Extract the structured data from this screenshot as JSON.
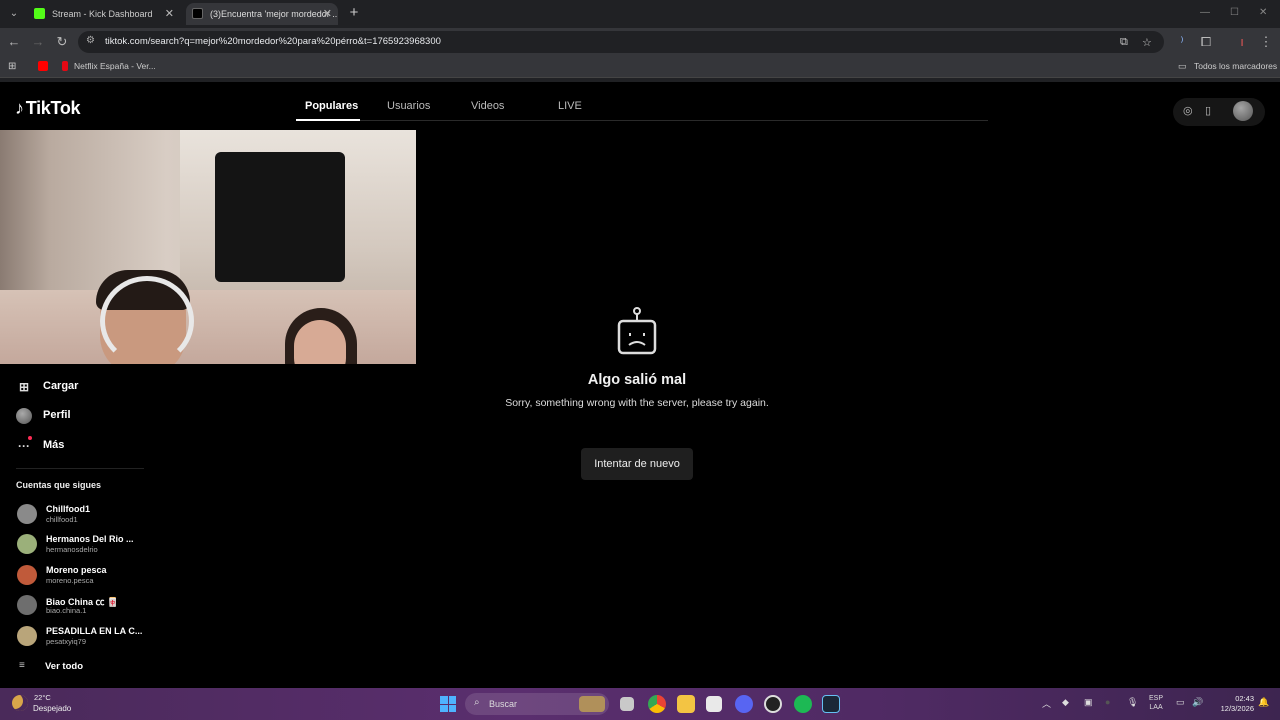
{
  "browser": {
    "tabs": [
      {
        "title": "Stream - Kick Dashboard",
        "favicon_color": "#53fc18"
      },
      {
        "title": "(3)Encuentra 'mejor mordedor ...",
        "favicon_color": "#000000"
      }
    ],
    "url": "tiktok.com/search?q=mejor%20mordedor%20para%20pérro&t=1765923968300",
    "bookmarks": [
      {
        "label": "Netflix España - Ver...",
        "color": "#e50914"
      }
    ],
    "bookmarks_folder": "Todos los marcadores"
  },
  "tiktok": {
    "logo": "TikTok",
    "tabs": [
      {
        "label": "Populares",
        "active": true
      },
      {
        "label": "Usuarios",
        "active": false
      },
      {
        "label": "Videos",
        "active": false
      },
      {
        "label": "LIVE",
        "active": false
      }
    ],
    "error": {
      "title": "Algo salió mal",
      "subtitle": "Sorry, something wrong with the server, please try again.",
      "retry_label": "Intentar de nuevo"
    },
    "sidebar": {
      "items": [
        {
          "label": "Cargar",
          "icon": "upload-icon"
        },
        {
          "label": "Perfil",
          "icon": "profile-avatar"
        },
        {
          "label": "Más",
          "icon": "more-icon"
        }
      ],
      "following_heading": "Cuentas que sigues",
      "following": [
        {
          "name": "Chillfood1",
          "handle": "chillfood1",
          "avatar_color": "#8a8a8a"
        },
        {
          "name": "Hermanos Del Rio ...",
          "handle": "hermanosdelrio",
          "avatar_color": "#9bb07a"
        },
        {
          "name": "Moreno pesca",
          "handle": "moreno.pesca",
          "avatar_color": "#c05a3a"
        },
        {
          "name": "Biao China ㏄ 🀄",
          "handle": "biao.china.1",
          "avatar_color": "#6e6e6e"
        },
        {
          "name": "PESADILLA EN LA C...",
          "handle": "pesatxyiq79",
          "avatar_color": "#b9a57a"
        }
      ],
      "see_all": "Ver todo"
    }
  },
  "taskbar": {
    "weather_temp": "22°C",
    "weather_desc": "Despejado",
    "search_placeholder": "Buscar",
    "lang_top": "ESP",
    "lang_bottom": "LAA",
    "time": "02:43",
    "date": "12/3/2026"
  }
}
